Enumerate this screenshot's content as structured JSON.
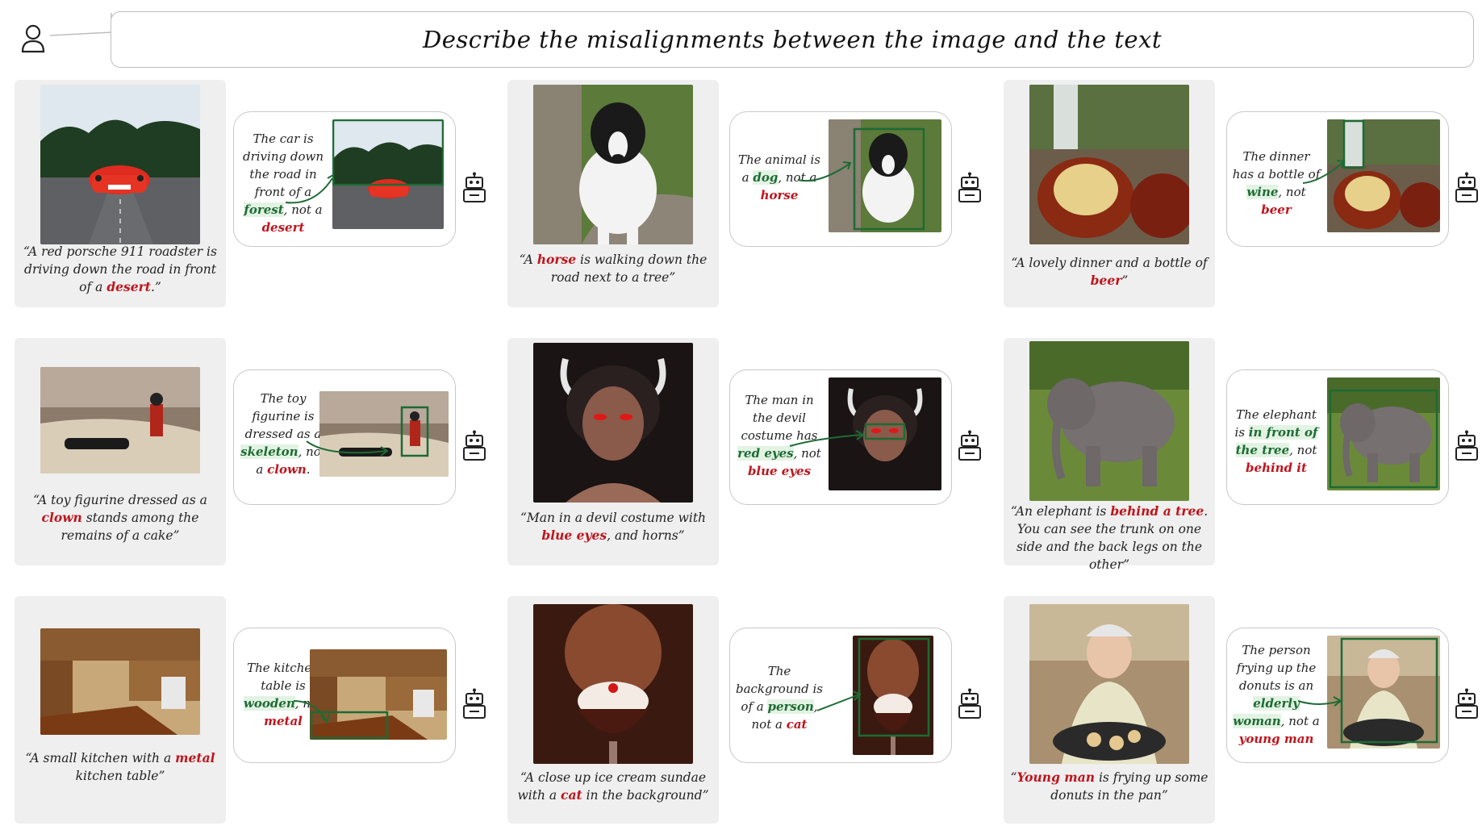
{
  "header": {
    "title": "Describe the misalignments between the image and the text"
  },
  "examples": [
    {
      "caption": [
        "“A red porsche 911 roadster is driving down the road in front of a ",
        "desert",
        ".”"
      ],
      "response": [
        "The car is driving down the road in front of a ",
        "forest",
        ", not a ",
        "desert"
      ]
    },
    {
      "caption": [
        "“A ",
        "horse",
        " is walking down the road next to a tree”"
      ],
      "response": [
        "The animal is a ",
        "dog",
        ", not a ",
        "horse"
      ]
    },
    {
      "caption": [
        "“A lovely dinner and a bottle of ",
        "beer",
        "”"
      ],
      "response": [
        "The dinner has a bottle of ",
        "wine",
        ", not ",
        "beer"
      ]
    },
    {
      "caption": [
        "“A toy figurine dressed as a ",
        "clown",
        " stands among the remains of a cake”"
      ],
      "response": [
        "The toy figurine is dressed as a ",
        "skeleton",
        ", not a ",
        "clown",
        "."
      ]
    },
    {
      "caption": [
        "“Man in a devil costume with ",
        "blue eyes",
        ", and horns”"
      ],
      "response": [
        "The man in the devil costume has ",
        "red eyes",
        ", not ",
        "blue eyes"
      ]
    },
    {
      "caption": [
        "“An elephant is ",
        "behind a tree",
        ". You can see the trunk on one side and the back legs on the other”"
      ],
      "response": [
        "The elephant is ",
        "in front of the tree",
        ", not ",
        "behind it"
      ]
    },
    {
      "caption": [
        "“A small kitchen with a ",
        "metal",
        " kitchen table”"
      ],
      "response": [
        "The kitchen table is ",
        "wooden",
        ", not ",
        "metal"
      ]
    },
    {
      "caption": [
        "“A close up ice cream sundae with a ",
        "cat",
        " in the background”"
      ],
      "response": [
        "The background is of a ",
        "person",
        ", not a ",
        "cat"
      ]
    },
    {
      "caption": [
        "“",
        "Young man",
        " is frying up some donuts in the pan”"
      ],
      "response": [
        "The person frying up the donuts is an ",
        "elderly woman",
        ", not a ",
        "young man"
      ]
    }
  ],
  "colors": {
    "mismatch": "#c0141c",
    "correct": "#1d6b34",
    "panel_bg": "#efefef",
    "box": "#1d6b34"
  },
  "icons": {
    "user": "user-icon",
    "robot": "robot-icon"
  }
}
